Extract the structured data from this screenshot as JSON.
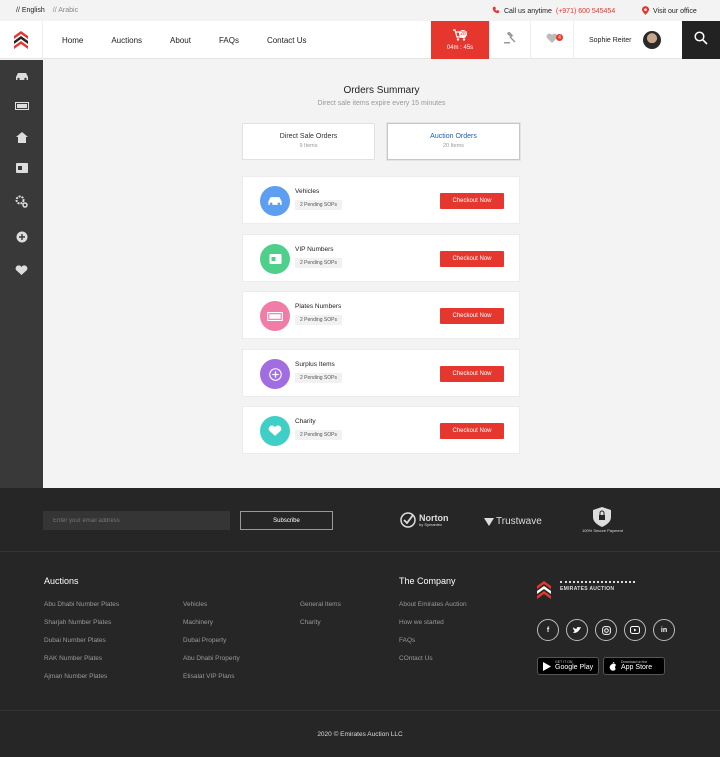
{
  "topbar": {
    "lang_en": "// English",
    "lang_ar": "// Arabic",
    "call_label": "Call us anytime",
    "call_number": "(+971) 600 545454",
    "visit_label": "Visit our office"
  },
  "header": {
    "nav": [
      "Home",
      "Auctions",
      "About",
      "FAQs",
      "Contact Us"
    ],
    "cart_count": "28",
    "cart_timer": "04m : 45s",
    "fav_count": "4",
    "user_name": "Sophie Reiter"
  },
  "main": {
    "title": "Orders Summary",
    "subtitle": "Direct sale items expire every 15 minutes",
    "tabs": [
      {
        "label": "Direct Sale Orders",
        "sub": "9 Items"
      },
      {
        "label": "Auction Orders",
        "sub": "20 Items"
      }
    ],
    "cards": [
      {
        "name": "Vehicles",
        "pending": "2 Pending SOPs",
        "button": "Checkout Now",
        "color": "#5d9ef0",
        "icon": "car-icon"
      },
      {
        "name": "VIP Numbers",
        "pending": "2 Pending SOPs",
        "button": "Checkout Now",
        "color": "#4ed08a",
        "icon": "sim-card-icon"
      },
      {
        "name": "Plates Numbers",
        "pending": "2 Pending SOPs",
        "button": "Checkout Now",
        "color": "#f07ca7",
        "icon": "plate-icon"
      },
      {
        "name": "Surplus Items",
        "pending": "2 Pending SOPs",
        "button": "Checkout Now",
        "color": "#a06ee0",
        "icon": "plus-icon"
      },
      {
        "name": "Charity",
        "pending": "2 Pending SOPs",
        "button": "Checkout Now",
        "color": "#3fcfc6",
        "icon": "heart-hands-icon"
      }
    ]
  },
  "footer": {
    "email_placeholder": "Enter your email address",
    "subscribe": "Subscribe",
    "norton_brand": "Norton",
    "norton_sub": "by Symantec",
    "trustwave_brand": "Trustwave",
    "secure_caption": "100% Secure Payment",
    "auctions_title": "Auctions",
    "auctions_col1": [
      "Abu Dhabi Number Plates",
      "Sharjah Number Plates",
      "Dubai Number Plates",
      "RAK Number Plates",
      "Ajman Number Plates"
    ],
    "auctions_col2": [
      "Vehicles",
      "Machinery",
      "Dubai Property",
      "Abu Dhabi Property",
      "Etisalat VIP Plans"
    ],
    "auctions_col3": [
      "General Items",
      "Charity"
    ],
    "company_title": "The Company",
    "company_links": [
      "About Emirates Auction",
      "How we started",
      "FAQs",
      "COntact Us"
    ],
    "brand_name": "EMIRATES AUCTION",
    "google_play_small": "GET IT ON",
    "google_play": "Google Play",
    "app_store_small": "Download on the",
    "app_store": "App Store",
    "copyright": "2020 © Emirates Auction LLC"
  }
}
